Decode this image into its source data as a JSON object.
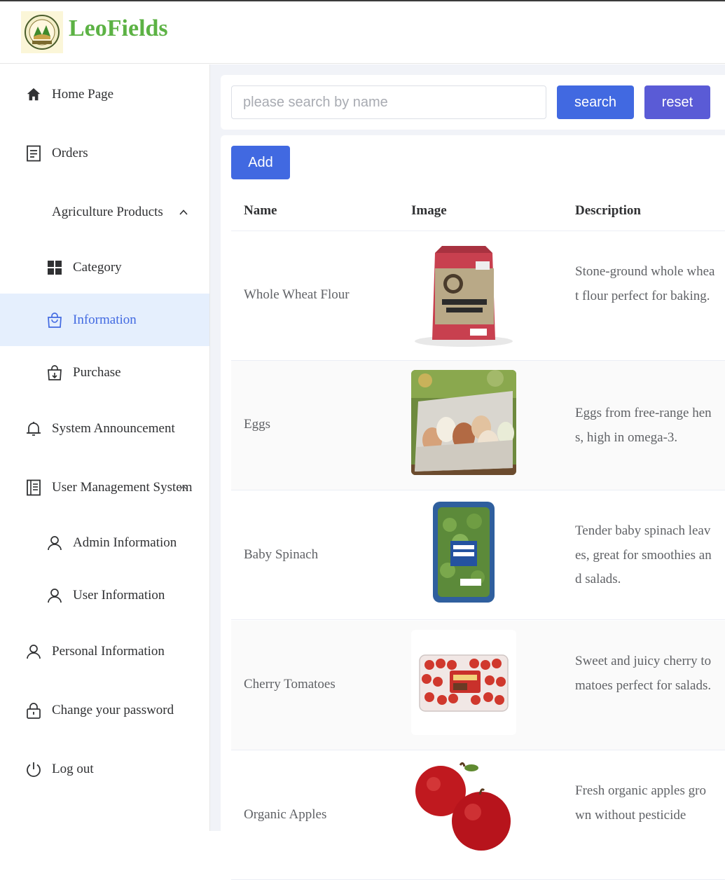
{
  "app": {
    "brand": "LeoFields",
    "colors": {
      "brand_green": "#5cb244",
      "primary": "#4169e1",
      "reset": "#5a5bd6",
      "active_bg": "#e5effd"
    }
  },
  "sidebar": {
    "home": {
      "label": "Home Page",
      "icon": "home-icon"
    },
    "orders": {
      "label": "Orders",
      "icon": "document-icon"
    },
    "agri_group": {
      "label": "Agriculture Products",
      "icon": "chevron-up-icon"
    },
    "category": {
      "label": "Category",
      "icon": "grid-icon"
    },
    "information": {
      "label": "Information",
      "icon": "shopping-bag-icon"
    },
    "purchase": {
      "label": "Purchase",
      "icon": "bag-download-icon"
    },
    "announcement": {
      "label": "System Announcement",
      "icon": "bell-icon"
    },
    "user_mgmt": {
      "label": "User Management System",
      "icon": "notebook-icon"
    },
    "admin_info": {
      "label": "Admin Information",
      "icon": "user-icon"
    },
    "user_info": {
      "label": "User Information",
      "icon": "user-icon"
    },
    "personal_info": {
      "label": "Personal Information",
      "icon": "user-icon"
    },
    "change_password": {
      "label": "Change your password",
      "icon": "lock-icon"
    },
    "logout": {
      "label": "Log out",
      "icon": "power-icon"
    }
  },
  "search": {
    "placeholder": "please search by name",
    "value": "",
    "search_label": "search",
    "reset_label": "reset"
  },
  "table": {
    "add_label": "Add",
    "columns": [
      "Name",
      "Image",
      "Description"
    ],
    "rows": [
      {
        "name": "Whole Wheat Flour",
        "image": "flour-bag",
        "description": "Stone-ground whole wheat flour perfect for baking."
      },
      {
        "name": "Eggs",
        "image": "egg-carton",
        "description": "Eggs from free-range hens, high in omega-3."
      },
      {
        "name": "Baby Spinach",
        "image": "spinach-pack",
        "description": "Tender baby spinach leaves, great for smoothies and salads."
      },
      {
        "name": "Cherry Tomatoes",
        "image": "tomato-pack",
        "description": "Sweet and juicy cherry tomatoes perfect for salads."
      },
      {
        "name": "Organic Apples",
        "image": "apples",
        "description": "Fresh organic apples grown without pesticide"
      }
    ]
  }
}
